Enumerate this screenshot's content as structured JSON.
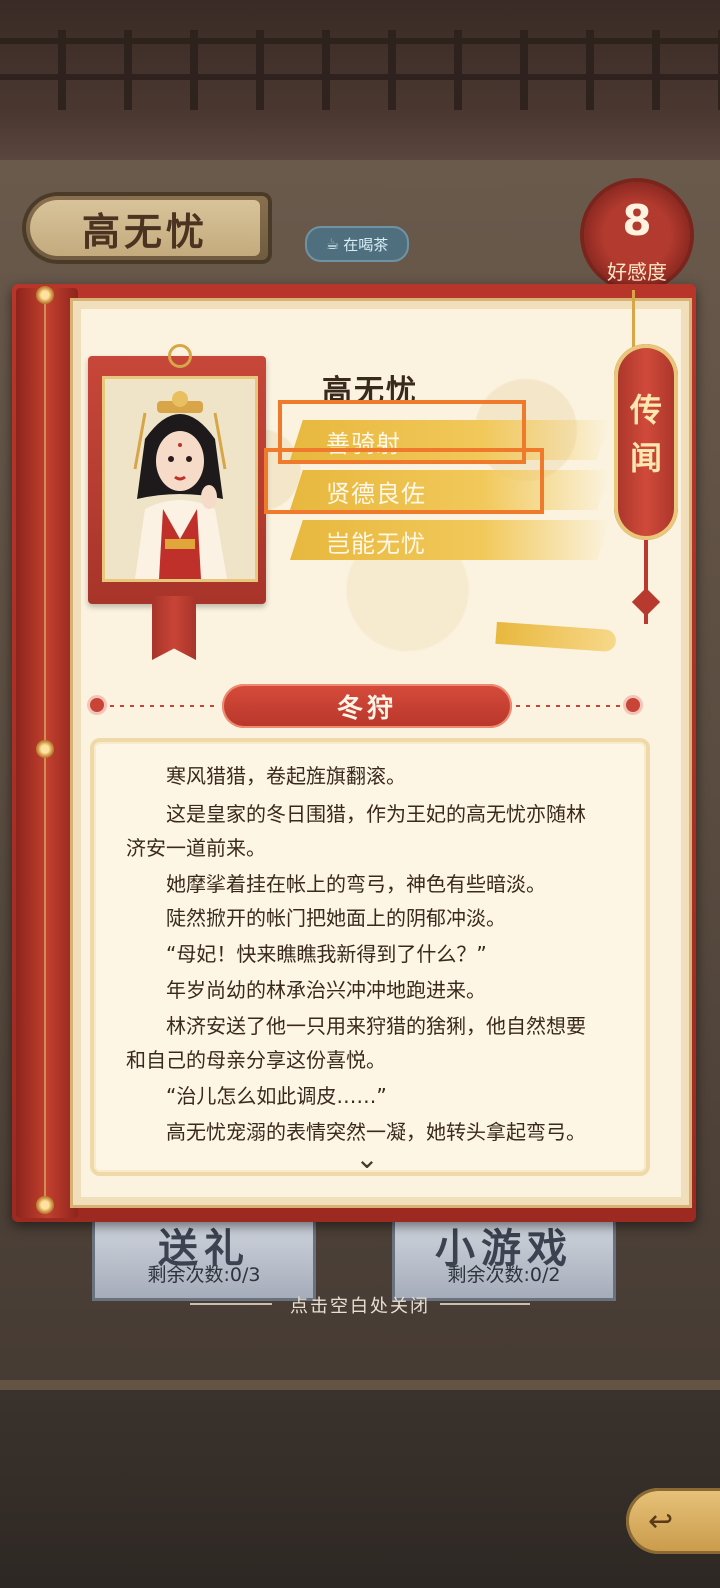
{
  "character": {
    "name": "高无忧",
    "status_badge": "在喝茶",
    "favor_value": "8",
    "favor_label": "好感度"
  },
  "profile": {
    "name": "高无忧",
    "traits": [
      "善骑射",
      "贤德良佐",
      "岂能无忧"
    ],
    "rumor_tab": "传闻"
  },
  "story": {
    "chapter_title": "冬狩",
    "lines": [
      "　　寒风猎猎，卷起旌旗翻滚。",
      "　　这是皇家的冬日围猎，作为王妃的高无忧亦随林",
      "济安一道前来。",
      "　　她摩挲着挂在帐上的弯弓，神色有些暗淡。",
      "　　陡然掀开的帐门把她面上的阴郁冲淡。",
      "　　“母妃！快来瞧瞧我新得到了什么？”",
      "　　年岁尚幼的林承治兴冲冲地跑进来。",
      "　　林济安送了他一只用来狩猎的猞猁，他自然想要",
      "和自己的母亲分享这份喜悦。",
      "　　“治儿怎么如此调皮……”",
      "　　高无忧宠溺的表情突然一凝，她转头拿起弯弓。"
    ]
  },
  "actions": {
    "gift_label": "送礼",
    "gift_remaining": "剩余次数:0/3",
    "minigame_label": "小游戏",
    "minigame_remaining": "剩余次数:0/2",
    "close_hint": "点击空白处关闭"
  },
  "colors": {
    "book_red": "#b8352a",
    "trait_gold": "#e8b83e",
    "highlight_orange": "#f07a2c",
    "page_cream": "#fbf3df"
  },
  "icons": [
    "tea-cup-icon",
    "chevron-down-icon",
    "back-arrow-icon"
  ]
}
